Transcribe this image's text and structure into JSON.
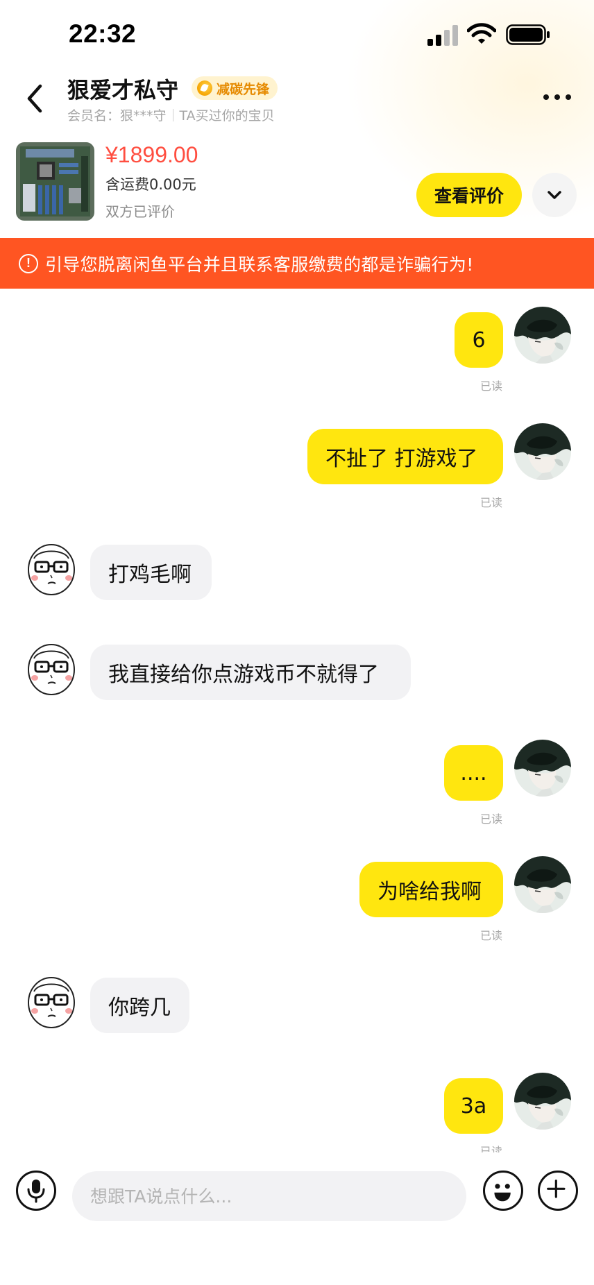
{
  "status_bar": {
    "time": "22:32"
  },
  "header": {
    "name": "狠爱才私守",
    "badge": "减碳先锋",
    "member_name": "会员名：狠***守",
    "relation": "TA买过你的宝贝"
  },
  "product": {
    "price": "¥1899.00",
    "shipping": "含运费0.00元",
    "rating_status": "双方已评价",
    "review_button": "查看评价"
  },
  "warning": {
    "icon": "!",
    "text": "引导您脱离闲鱼平台并且联系客服缴费的都是诈骗行为!"
  },
  "messages": [
    {
      "from": "me",
      "text": "6",
      "status": "已读"
    },
    {
      "from": "me",
      "text": "不扯了 打游戏了",
      "status": "已读"
    },
    {
      "from": "them",
      "text": "打鸡毛啊"
    },
    {
      "from": "them",
      "text": "我直接给你点游戏币不就得了"
    },
    {
      "from": "me",
      "text": "....",
      "status": "已读"
    },
    {
      "from": "me",
      "text": "为啥给我啊",
      "status": "已读"
    },
    {
      "from": "them",
      "text": "你跨几"
    },
    {
      "from": "me",
      "text": "3a",
      "status": "已读"
    }
  ],
  "input_bar": {
    "placeholder": "想跟TA说点什么..."
  },
  "colors": {
    "accent_yellow": "#ffe60f",
    "price_red": "#ff4e40",
    "warning_orange": "#ff5522",
    "their_bubble": "#f2f2f4"
  },
  "icons": {
    "back": "chevron-left-icon",
    "more": "more-dots-icon",
    "expand": "chevron-down-icon",
    "voice": "microphone-icon",
    "emoji": "smiley-icon",
    "add": "plus-icon"
  }
}
